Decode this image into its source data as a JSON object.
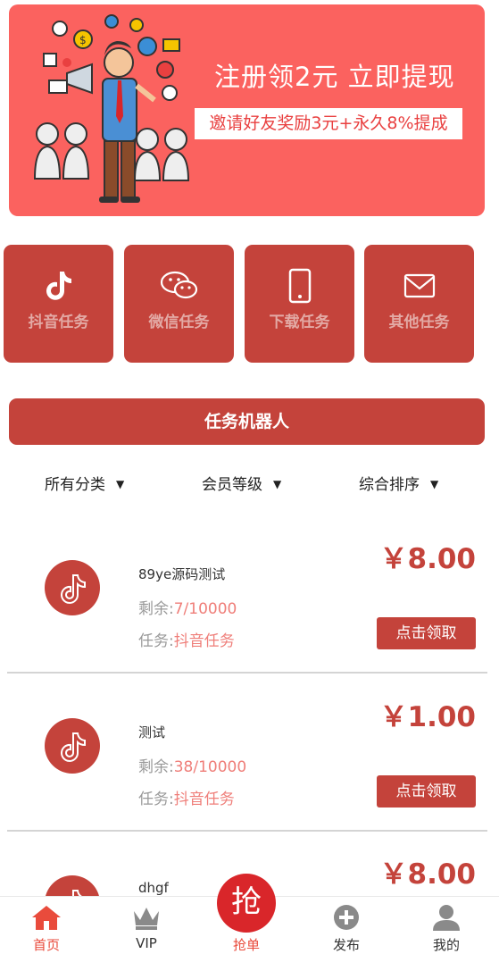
{
  "banner": {
    "title": "注册领2元 立即提现",
    "subtitle": "邀请好友奖励3元+永久8%提成"
  },
  "categories": [
    {
      "label": "抖音任务",
      "icon": "tiktok-icon"
    },
    {
      "label": "微信任务",
      "icon": "wechat-icon"
    },
    {
      "label": "下载任务",
      "icon": "phone-icon"
    },
    {
      "label": "其他任务",
      "icon": "mail-icon"
    }
  ],
  "robot_button": "任务机器人",
  "filters": [
    {
      "label": "所有分类",
      "arrow": "▼"
    },
    {
      "label": "会员等级",
      "arrow": "▼"
    },
    {
      "label": "综合排序",
      "arrow": "▼"
    }
  ],
  "tasks": [
    {
      "name": "89ye源码测试",
      "remain_label": "剩余:",
      "remain": "7/10000",
      "kind_label": "任务:",
      "kind": "抖音任务",
      "price": "￥8.00",
      "claim": "点击领取"
    },
    {
      "name": "测试",
      "remain_label": "剩余:",
      "remain": "38/10000",
      "kind_label": "任务:",
      "kind": "抖音任务",
      "price": "￥1.00",
      "claim": "点击领取"
    },
    {
      "name": "dhgf",
      "price": "￥8.00"
    }
  ],
  "tabbar": {
    "items": [
      {
        "label": "首页",
        "icon": "home-icon",
        "active": true
      },
      {
        "label": "VIP",
        "icon": "crown-icon"
      },
      {
        "label": "抢单",
        "icon": "grab-icon",
        "glyph": "抢"
      },
      {
        "label": "发布",
        "icon": "plus-circle-icon"
      },
      {
        "label": "我的",
        "icon": "user-icon"
      }
    ]
  },
  "colors": {
    "brand": "#c4433b",
    "banner": "#fb625f",
    "accent_text": "#ef7e79",
    "tab_active": "#e94b3c",
    "grab": "#d9262a"
  }
}
